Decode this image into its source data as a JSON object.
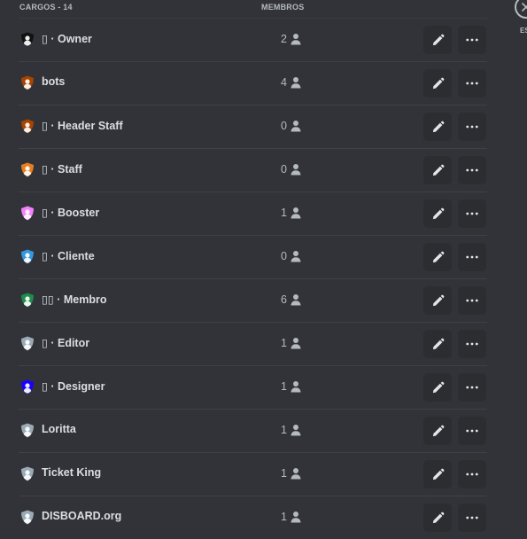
{
  "header": {
    "roles_label": "CARGOS - 14",
    "members_label": "MEMBROS"
  },
  "close": {
    "esc_label": "ES"
  },
  "roles": [
    {
      "name": "▯ · Owner",
      "members": "2",
      "color": "#111111"
    },
    {
      "name": "bots",
      "members": "4",
      "color": "#a84300"
    },
    {
      "name": "▯ · Header Staff",
      "members": "0",
      "color": "#a84300"
    },
    {
      "name": "▯ · Staff",
      "members": "0",
      "color": "#e67e22"
    },
    {
      "name": "▯ · Booster",
      "members": "1",
      "color": "#f47fff"
    },
    {
      "name": "▯ · Cliente",
      "members": "0",
      "color": "#3498db"
    },
    {
      "name": "▯▯ · Membro",
      "members": "6",
      "color": "#1f8b4c"
    },
    {
      "name": "▯ · Editor",
      "members": "1",
      "color": "#99aab5"
    },
    {
      "name": "▯ · Designer",
      "members": "1",
      "color": "#1c00ff"
    },
    {
      "name": "Loritta",
      "members": "1",
      "color": "#99aab5"
    },
    {
      "name": "Ticket King",
      "members": "1",
      "color": "#99aab5"
    },
    {
      "name": "DISBOARD.org",
      "members": "1",
      "color": "#99aab5"
    }
  ],
  "icons": {
    "role": "shield-icon",
    "members": "person-icon",
    "edit": "pencil-icon",
    "more": "more-icon",
    "close": "close-icon"
  }
}
